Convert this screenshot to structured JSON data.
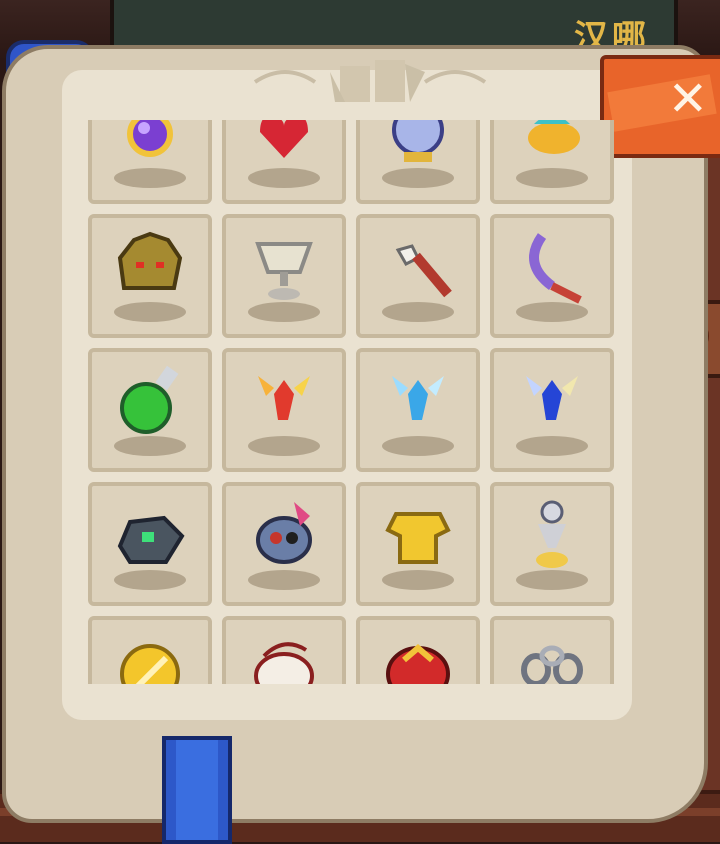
{
  "top_bar": {
    "label": "汉哪"
  },
  "close_button": {
    "icon": "close-x-icon",
    "glyph": "✕",
    "color": "#e8642a"
  },
  "inventory": {
    "rows": [
      [
        "purple-amulet-icon",
        "red-heart-trinket-icon",
        "crystal-orb-icon",
        "golden-lamp-icon"
      ],
      [
        "golden-beast-mask-icon",
        "silver-chalice-icon",
        "bone-hand-sword-icon",
        "purple-scimitar-icon"
      ],
      [
        "green-potion-flask-icon",
        "fire-fairy-icon",
        "ice-fairy-icon",
        "blue-fairy-icon"
      ],
      [
        "mechanical-bomb-icon",
        "demon-skull-mask-icon",
        "golden-armor-icon",
        "silver-hourglass-idol-icon"
      ],
      [
        "gold-coin-shield-icon",
        "white-beast-skull-icon",
        "red-lion-helm-icon",
        "iron-chain-icon"
      ]
    ]
  },
  "colors": {
    "page": "#eae2d1",
    "slot": "#ddd2bc",
    "slot_border": "#c6b89d",
    "leather": "#6b3425",
    "accent_orange": "#e8642a",
    "bookmark_blue": "#2d58c9"
  }
}
